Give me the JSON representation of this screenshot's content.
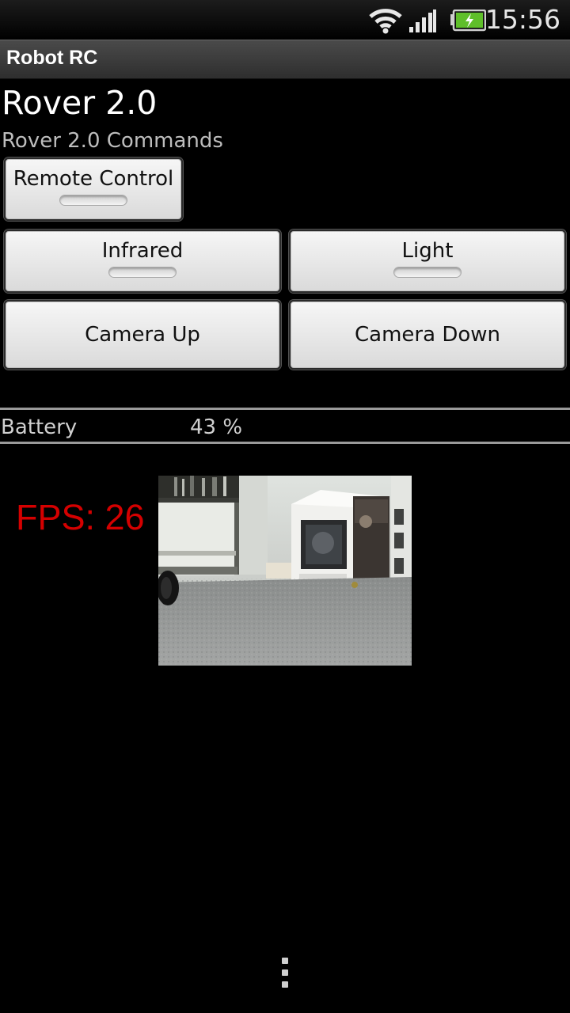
{
  "status_bar": {
    "time": "15:56",
    "icons": [
      "wifi-icon",
      "signal-icon",
      "battery-charging-icon"
    ]
  },
  "app": {
    "title": "Robot RC"
  },
  "device": {
    "name": "Rover 2.0",
    "commands_label": "Rover 2.0 Commands"
  },
  "buttons": {
    "remote_control": "Remote Control",
    "infrared": "Infrared",
    "light": "Light",
    "camera_up": "Camera Up",
    "camera_down": "Camera Down"
  },
  "battery": {
    "label": "Battery",
    "value": "43 %"
  },
  "video": {
    "fps_text": "FPS: 26"
  },
  "colors": {
    "fps_text": "#d40000",
    "battery_icon": "#5fbf2a"
  }
}
